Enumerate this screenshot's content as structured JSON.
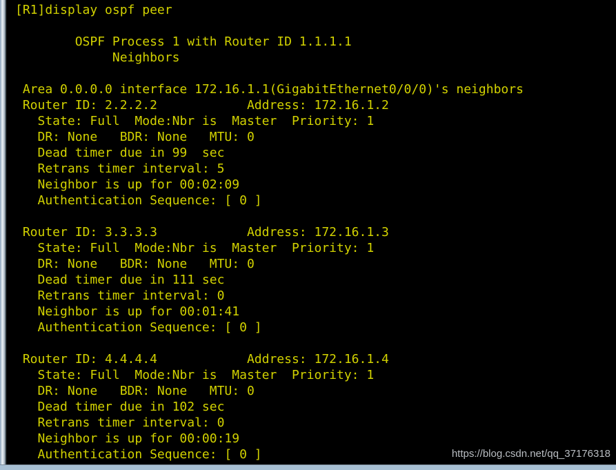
{
  "window": {
    "name": "network-device-cli-console",
    "background_color": "#000000",
    "text_color": "#d2d200",
    "frame_color": "#a8c0d4"
  },
  "console": {
    "prompt_line": "[R1]display ospf peer",
    "lines": [
      "[R1]display ospf peer",
      "",
      "        OSPF Process 1 with Router ID 1.1.1.1",
      "             Neighbors",
      "",
      " Area 0.0.0.0 interface 172.16.1.1(GigabitEthernet0/0/0)'s neighbors",
      " Router ID: 2.2.2.2            Address: 172.16.1.2",
      "   State: Full  Mode:Nbr is  Master  Priority: 1",
      "   DR: None   BDR: None   MTU: 0",
      "   Dead timer due in 99  sec",
      "   Retrans timer interval: 5",
      "   Neighbor is up for 00:02:09",
      "   Authentication Sequence: [ 0 ]",
      "",
      " Router ID: 3.3.3.3            Address: 172.16.1.3",
      "   State: Full  Mode:Nbr is  Master  Priority: 1",
      "   DR: None   BDR: None   MTU: 0",
      "   Dead timer due in 111 sec",
      "   Retrans timer interval: 0",
      "   Neighbor is up for 00:01:41",
      "   Authentication Sequence: [ 0 ]",
      "",
      " Router ID: 4.4.4.4            Address: 172.16.1.4",
      "   State: Full  Mode:Nbr is  Master  Priority: 1",
      "   DR: None   BDR: None   MTU: 0",
      "   Dead timer due in 102 sec",
      "   Retrans timer interval: 0",
      "   Neighbor is up for 00:00:19",
      "   Authentication Sequence: [ 0 ]"
    ],
    "command": "display ospf peer",
    "device_prompt": "[R1]",
    "ospf_process_id": "1",
    "local_router_id": "1.1.1.1",
    "area_id": "0.0.0.0",
    "area_interface_ip": "172.16.1.1",
    "area_interface_name": "GigabitEthernet0/0/0",
    "neighbors": [
      {
        "router_id": "2.2.2.2",
        "address": "172.16.1.2",
        "state": "Full",
        "mode": "Nbr is  Master",
        "priority": "1",
        "dr": "None",
        "bdr": "None",
        "mtu": "0",
        "dead_timer_sec": "99",
        "retrans_timer_interval": "5",
        "neighbor_up_for": "00:02:09",
        "authentication_sequence": "[ 0 ]"
      },
      {
        "router_id": "3.3.3.3",
        "address": "172.16.1.3",
        "state": "Full",
        "mode": "Nbr is  Master",
        "priority": "1",
        "dr": "None",
        "bdr": "None",
        "mtu": "0",
        "dead_timer_sec": "111",
        "retrans_timer_interval": "0",
        "neighbor_up_for": "00:01:41",
        "authentication_sequence": "[ 0 ]"
      },
      {
        "router_id": "4.4.4.4",
        "address": "172.16.1.4",
        "state": "Full",
        "mode": "Nbr is  Master",
        "priority": "1",
        "dr": "None",
        "bdr": "None",
        "mtu": "0",
        "dead_timer_sec": "102",
        "retrans_timer_interval": "0",
        "neighbor_up_for": "00:00:19",
        "authentication_sequence": "[ 0 ]"
      }
    ]
  },
  "watermark": {
    "text": "https://blog.csdn.net/qq_37176318"
  }
}
